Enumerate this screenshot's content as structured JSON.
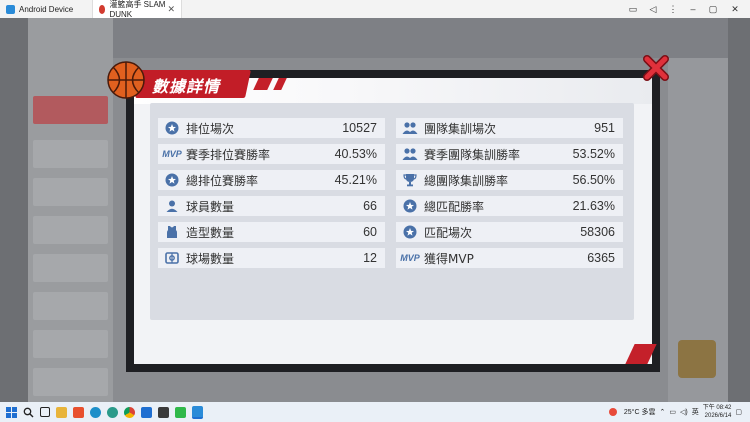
{
  "window": {
    "tab1_title": "Android Device",
    "tab2_title": "灌籃高手 SLAM DUNK"
  },
  "panel": {
    "title": "數據詳情"
  },
  "stats": {
    "left": [
      {
        "icon": "star-badge-icon",
        "label": "排位場次",
        "value": "10527"
      },
      {
        "icon": "mvp-icon",
        "label": "賽季排位賽勝率",
        "value": "40.53%"
      },
      {
        "icon": "star-badge-icon",
        "label": "總排位賽勝率",
        "value": "45.21%"
      },
      {
        "icon": "player-icon",
        "label": "球員數量",
        "value": "66"
      },
      {
        "icon": "jersey-icon",
        "label": "造型數量",
        "value": "60"
      },
      {
        "icon": "court-icon",
        "label": "球場數量",
        "value": "12"
      }
    ],
    "right": [
      {
        "icon": "team-icon",
        "label": "團隊集訓場次",
        "value": "951"
      },
      {
        "icon": "team-icon",
        "label": "賽季團隊集訓勝率",
        "value": "53.52%"
      },
      {
        "icon": "trophy-icon",
        "label": "總團隊集訓勝率",
        "value": "56.50%"
      },
      {
        "icon": "star-badge-icon",
        "label": "總匹配勝率",
        "value": "21.63%"
      },
      {
        "icon": "star-badge-icon",
        "label": "匹配場次",
        "value": "58306"
      },
      {
        "icon": "mvp-icon",
        "label": "獲得MVP",
        "value": "6365"
      }
    ],
    "mvp_text": "MVP"
  },
  "taskbar": {
    "weather": "25°C 多雲",
    "ime": "英",
    "time": "下午 08:42",
    "date": "2026/6/14"
  },
  "colors": {
    "accent_red": "#c21d27",
    "icon_blue": "#4a71a8",
    "row_bg": "#eef0f5"
  }
}
